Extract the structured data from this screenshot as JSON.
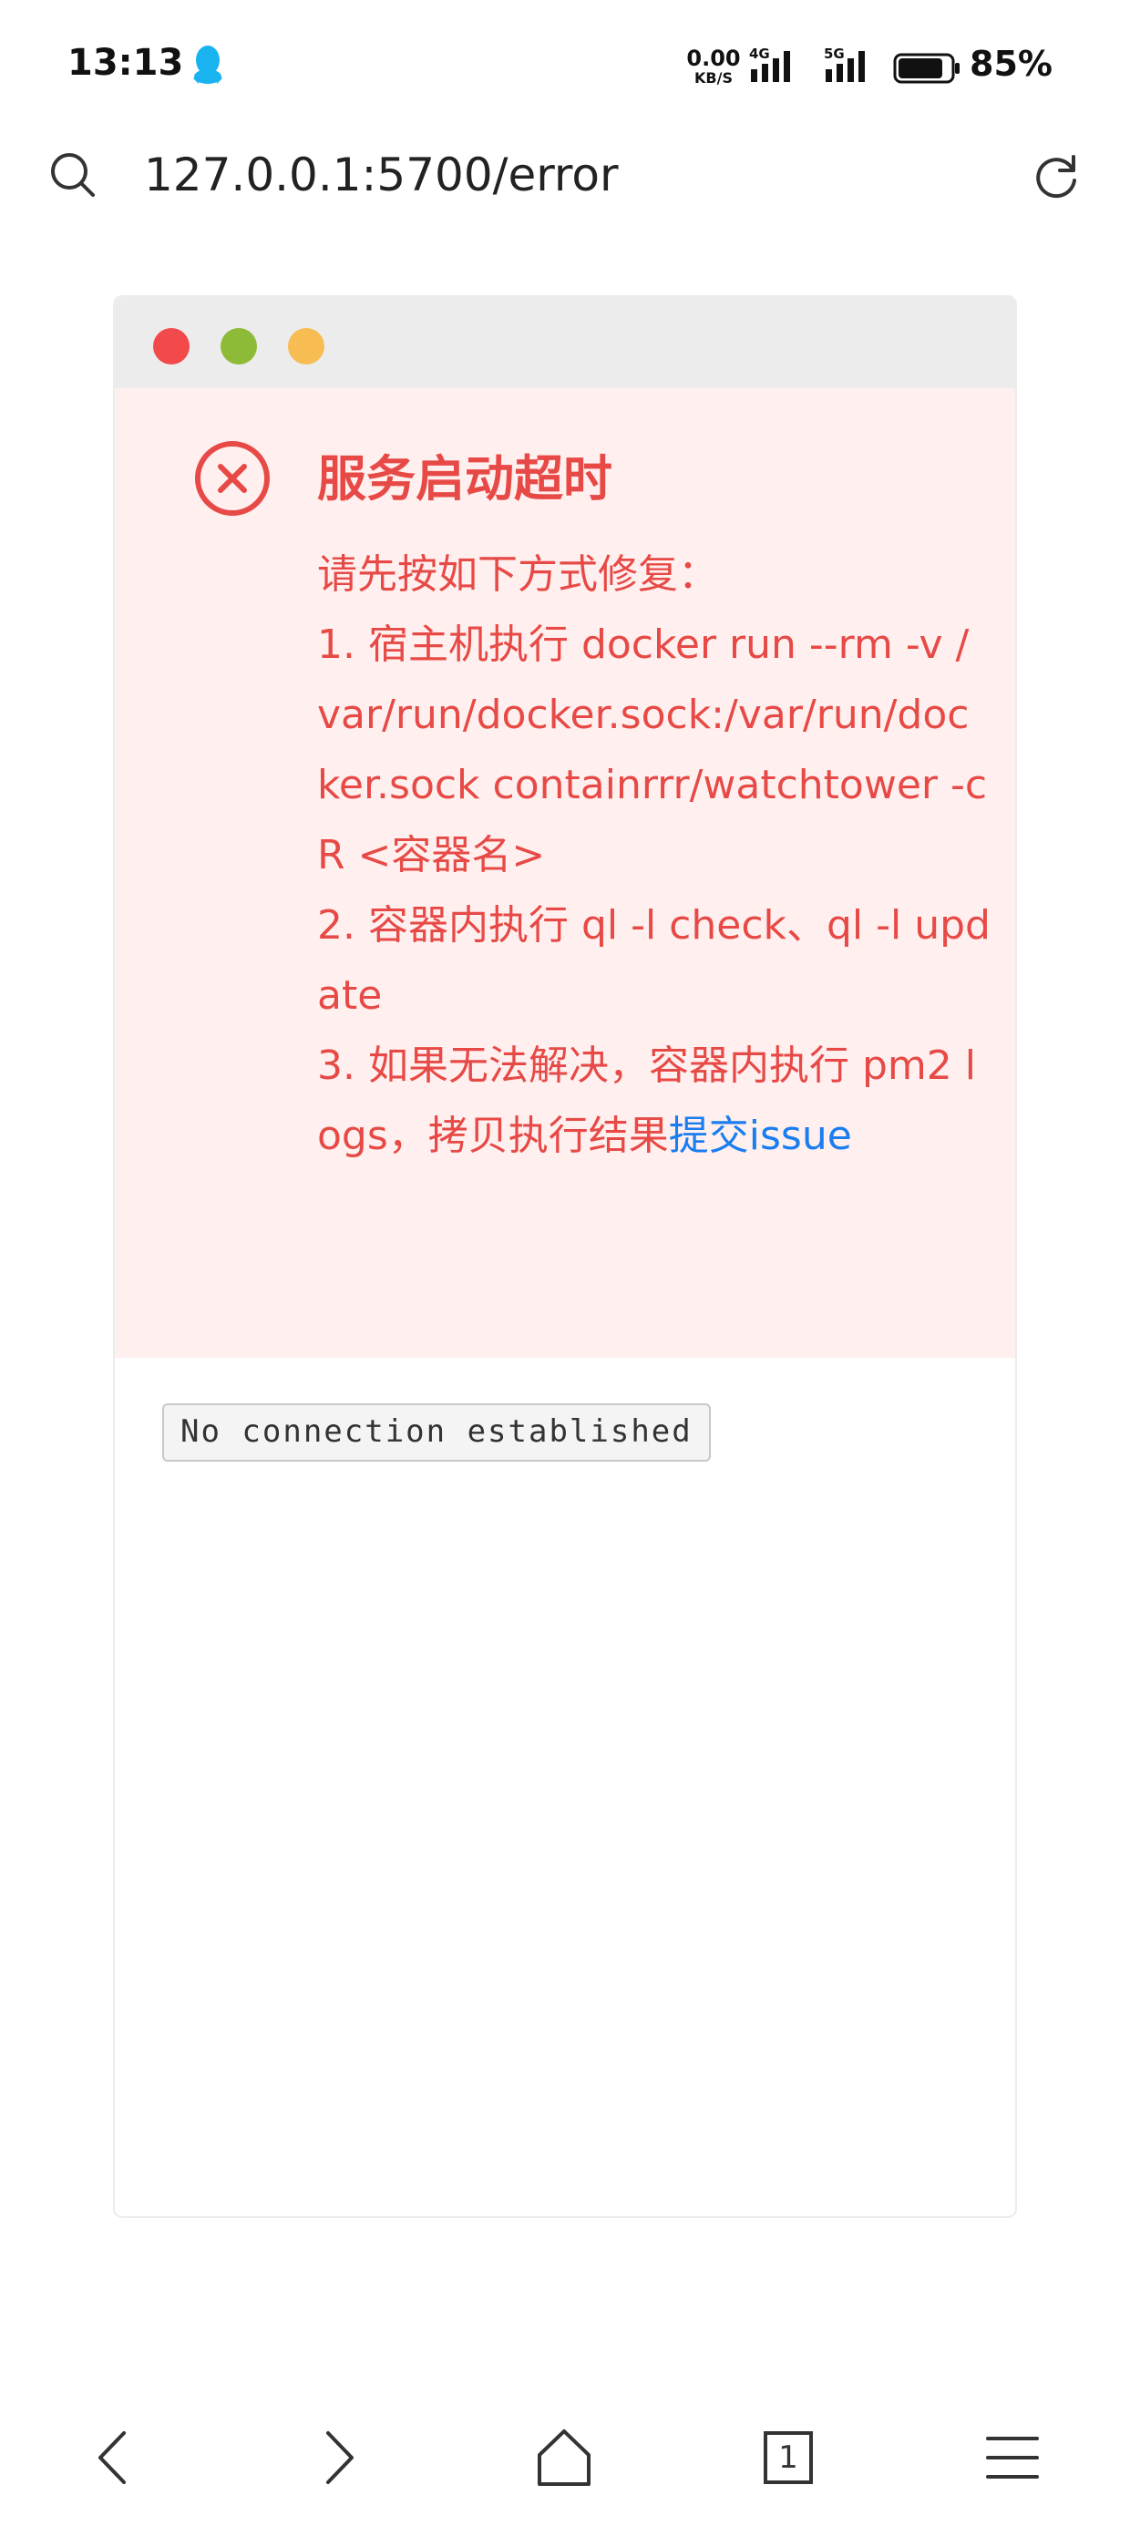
{
  "status_bar": {
    "time": "13:13",
    "net_speed_value": "0.00",
    "net_speed_unit": "KB/S",
    "signal_1": "4G",
    "signal_2": "5G",
    "battery_percent": "85%",
    "battery_level": 0.85,
    "icons": [
      "qq-icon",
      "signal-4g-icon",
      "signal-5g-icon",
      "battery-icon"
    ]
  },
  "address_bar": {
    "url": "127.0.0.1:5700/error",
    "icons": [
      "search-icon",
      "refresh-icon"
    ]
  },
  "window": {
    "dots": [
      {
        "name": "close",
        "color": "#f24a4a"
      },
      {
        "name": "minimize",
        "color": "#8ebb37"
      },
      {
        "name": "maximize",
        "color": "#f8bd52"
      }
    ],
    "error": {
      "icon": "error-circle-x-icon",
      "color": "#e74a46",
      "title": "服务启动超时",
      "intro": "请先按如下方式修复：",
      "step1": "1. 宿主机执行 docker run --rm -v /var/run/docker.sock:/var/run/docker.sock containrrr/watchtower -cR <容器名>",
      "step2": "2. 容器内执行 ql -l check、ql -l update",
      "step3_text": "3. 如果无法解决，容器内执行 pm2 logs，拷贝执行结果",
      "step3_link": "提交issue",
      "link_color": "#1a7df0"
    },
    "connection_status": "No connection established"
  },
  "bottom_nav": {
    "tab_count": "1",
    "icons": [
      "back-icon",
      "forward-icon",
      "home-icon",
      "tabs-icon",
      "menu-icon"
    ]
  }
}
